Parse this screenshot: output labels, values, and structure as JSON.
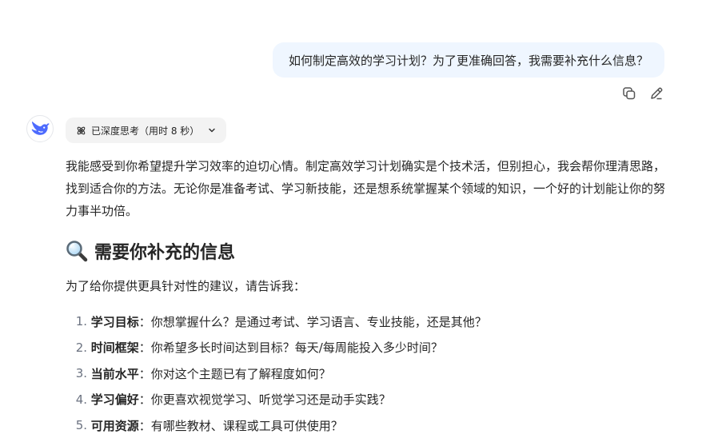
{
  "user_message": {
    "text": "如何制定高效的学习计划？为了更准确回答，我需要补充什么信息？",
    "actions": [
      {
        "icon": "copy-icon",
        "name": "copy-button"
      },
      {
        "icon": "edit-icon",
        "name": "edit-button"
      }
    ]
  },
  "assistant": {
    "avatar_icon": "whale-logo-icon",
    "thinking_label": "已深度思考（用时 8 秒）",
    "intro_paragraph": "我能感受到你希望提升学习效率的迫切心情。制定高效学习计划确实是个技术活，但别担心，我会帮你理清思路，找到适合你的方法。无论你是准备考试、学习新技能，还是想系统掌握某个领域的知识，一个好的计划能让你的努力事半功倍。",
    "section_title": "需要你补充的信息",
    "section_icon": "magnifier-icon",
    "section_intro": "为了给你提供更具针对性的建议，请告诉我：",
    "items": [
      {
        "num": "1.",
        "term": "学习目标",
        "text": "：你想掌握什么？是通过考试、学习语言、专业技能，还是其他？"
      },
      {
        "num": "2.",
        "term": "时间框架",
        "text": "：你希望多长时间达到目标？每天/每周能投入多少时间？"
      },
      {
        "num": "3.",
        "term": "当前水平",
        "text": "：你对这个主题已有了解程度如何？"
      },
      {
        "num": "4.",
        "term": "学习偏好",
        "text": "：你更喜欢视觉学习、听觉学习还是动手实践？"
      },
      {
        "num": "5.",
        "term": "可用资源",
        "text": "：有哪些教材、课程或工具可供使用？"
      }
    ]
  },
  "colors": {
    "bubble_bg": "#eff6ff",
    "pill_bg": "#f3f3f3",
    "brand_blue": "#4d6bfe",
    "text": "#262626"
  }
}
